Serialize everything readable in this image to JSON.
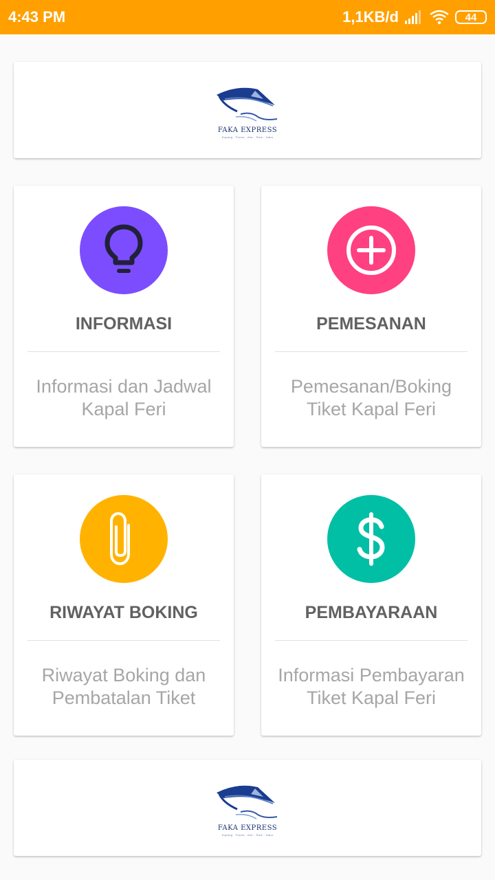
{
  "status_bar": {
    "time": "4:43 PM",
    "network_speed": "1,1KB/d",
    "battery": "44",
    "signal_icon": "signal-icon",
    "wifi_icon": "wifi-icon"
  },
  "logo": {
    "name": "FAKA EXPRESS",
    "tagline": "Kupang · Flores · Alor · Rote · Sabu"
  },
  "menu": [
    {
      "title": "INFORMASI",
      "description": "Informasi dan Jadwal Kapal Feri",
      "icon": "lightbulb-icon",
      "color": "#7c4dff"
    },
    {
      "title": "PEMESANAN",
      "description": "Pemesanan/Boking Tiket Kapal Feri",
      "icon": "add-circle-icon",
      "color": "#ff4081"
    },
    {
      "title": "RIWAYAT BOKING",
      "description": "Riwayat Boking dan Pembatalan Tiket",
      "icon": "paperclip-icon",
      "color": "#ffb300"
    },
    {
      "title": "PEMBAYARAAN",
      "description": "Informasi Pembayaran Tiket Kapal Feri",
      "icon": "dollar-icon",
      "color": "#00bfa5"
    }
  ]
}
